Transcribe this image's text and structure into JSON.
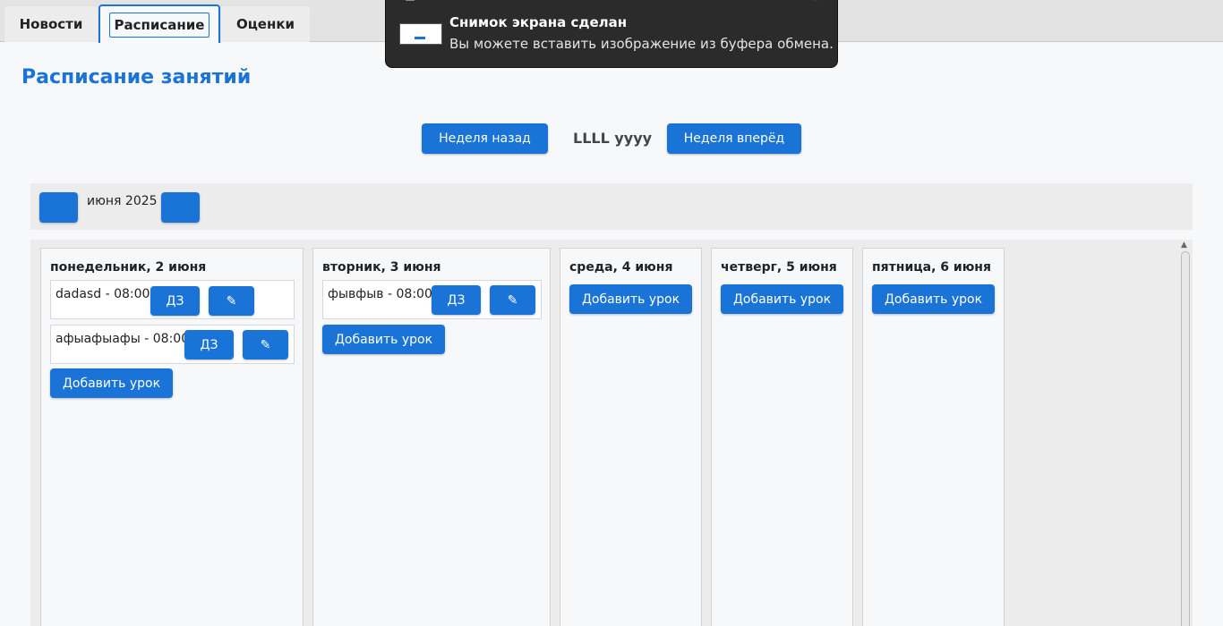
{
  "tabs": [
    {
      "label": "Новости"
    },
    {
      "label": "Расписание"
    },
    {
      "label": "Оценки"
    }
  ],
  "notification": {
    "title": "Снимок экрана сделан",
    "message": "Вы можете вставить изображение из буфера обмена."
  },
  "page_title": "Расписание занятий",
  "week_nav": {
    "prev_label": "Неделя назад",
    "current": "LLLL yyyy",
    "next_label": "Неделя вперёд"
  },
  "month_nav": {
    "label": "июня 2025"
  },
  "days": [
    {
      "title": "понедельник, 2 июня",
      "lessons": [
        {
          "text": "dadasd - 08:00",
          "hw_label": "ДЗ",
          "edit_label": "✎"
        },
        {
          "text": "афыафыафы - 08:00",
          "hw_label": "ДЗ",
          "edit_label": "✎"
        }
      ],
      "add_label": "Добавить урок"
    },
    {
      "title": "вторник, 3 июня",
      "lessons": [
        {
          "text": "фывфыв - 08:00",
          "hw_label": "ДЗ",
          "edit_label": "✎"
        }
      ],
      "add_label": "Добавить урок"
    },
    {
      "title": "среда, 4 июня",
      "lessons": [],
      "add_label": "Добавить урок"
    },
    {
      "title": "четверг, 5 июня",
      "lessons": [],
      "add_label": "Добавить урок"
    },
    {
      "title": "пятница, 6 июня",
      "lessons": [],
      "add_label": "Добавить урок"
    }
  ],
  "colors": {
    "accent": "#1a73d6",
    "background": "#f7f8fa",
    "notification_bg": "#2b2b2b"
  }
}
